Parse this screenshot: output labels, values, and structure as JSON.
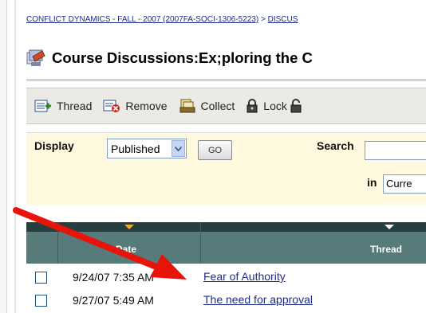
{
  "breadcrumb": {
    "course": "CONFLICT DYNAMICS - FALL - 2007 (2007FA-SOCI-1306-5223)",
    "separator": ">",
    "current": "DISCUS"
  },
  "title": "Course Discussions:Ex;ploring the C",
  "toolbar": {
    "thread": "Thread",
    "remove": "Remove",
    "collect": "Collect",
    "lock": "Lock"
  },
  "filter": {
    "display_label": "Display",
    "display_value": "Published",
    "go_label": "GO",
    "search_label": "Search",
    "search_value": "",
    "in_label": "in",
    "in_value": "Curre"
  },
  "table": {
    "headers": {
      "date": "Date",
      "thread": "Thread"
    },
    "rows": [
      {
        "date": "9/24/07 7:35 AM",
        "thread": "Fear of Authority"
      },
      {
        "date": "9/27/07 5:49 AM",
        "thread": "The need for approval"
      }
    ]
  },
  "colors": {
    "annotation_arrow": "#e8140c",
    "table_header": "#577b7a",
    "link": "#1c2c8c"
  },
  "icons": [
    "title-discussion-icon",
    "new-thread-icon",
    "remove-icon",
    "collect-icon",
    "lock-icon",
    "unlock-icon",
    "dropdown-arrow-icon",
    "sort-triangle-icon"
  ]
}
